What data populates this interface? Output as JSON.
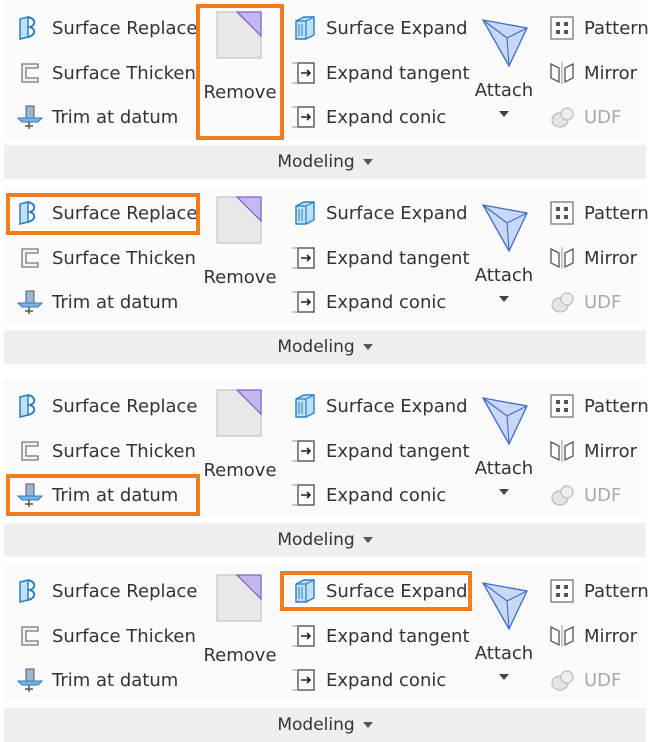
{
  "colors": {
    "highlight": "#f07e1e",
    "ribbon_bg": "#fbfbfb",
    "group_bar_bg": "#efefef"
  },
  "ribbon": {
    "surface_replace": "Surface Replace",
    "surface_thicken": "Surface Thicken",
    "trim_at_datum": "Trim at datum",
    "remove": "Remove",
    "surface_expand": "Surface Expand",
    "expand_tangent": "Expand tangent",
    "expand_conic": "Expand conic",
    "attach": "Attach",
    "pattern": "Pattern",
    "mirror": "Mirror",
    "udf": "UDF",
    "group_label": "Modeling"
  },
  "icons": [
    "surface-replace-icon",
    "surface-thicken-icon",
    "trim-datum-icon",
    "remove-icon",
    "surface-expand-icon",
    "expand-tangent-icon",
    "expand-conic-icon",
    "attach-icon",
    "pattern-icon",
    "mirror-icon",
    "udf-icon"
  ],
  "panels": [
    {
      "highlighted": "remove"
    },
    {
      "highlighted": "surface_replace"
    },
    {
      "highlighted": "trim_at_datum"
    },
    {
      "highlighted": "surface_expand"
    }
  ]
}
